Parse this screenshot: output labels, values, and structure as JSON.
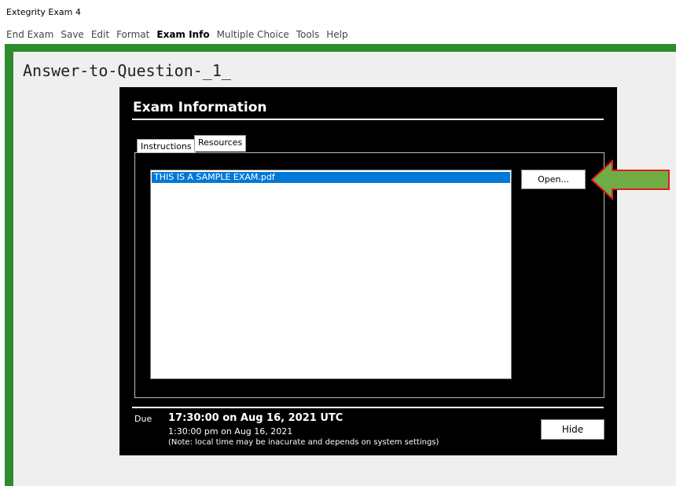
{
  "app": {
    "title": "Extegrity Exam 4"
  },
  "menu": [
    {
      "label": "End Exam"
    },
    {
      "label": "Save"
    },
    {
      "label": "Edit"
    },
    {
      "label": "Format"
    },
    {
      "label": "Exam Info"
    },
    {
      "label": "Multiple Choice"
    },
    {
      "label": "Tools"
    },
    {
      "label": "Help"
    }
  ],
  "document": {
    "title": "Answer-to-Question-_1_"
  },
  "dialog": {
    "title": "Exam Information",
    "tabs": [
      {
        "label": "Instructions"
      },
      {
        "label": "Resources"
      }
    ],
    "resources": [
      {
        "name": "THIS IS A SAMPLE EXAM.pdf"
      }
    ],
    "open_label": "Open...",
    "due": {
      "label": "Due",
      "utc": "17:30:00 on Aug 16, 2021 UTC",
      "local": "1:30:00 pm on Aug 16, 2021",
      "note": "(Note: local time may be inacurate and depends on system settings)"
    },
    "hide_label": "Hide"
  },
  "annotation": {
    "arrow_icon": "left-arrow-icon",
    "arrow_fill": "#70ad47",
    "arrow_outline": "#e31c1c"
  },
  "colors": {
    "frame_green": "#2e8b2e",
    "selection_blue": "#0078d7",
    "dialog_bg": "#000000"
  }
}
